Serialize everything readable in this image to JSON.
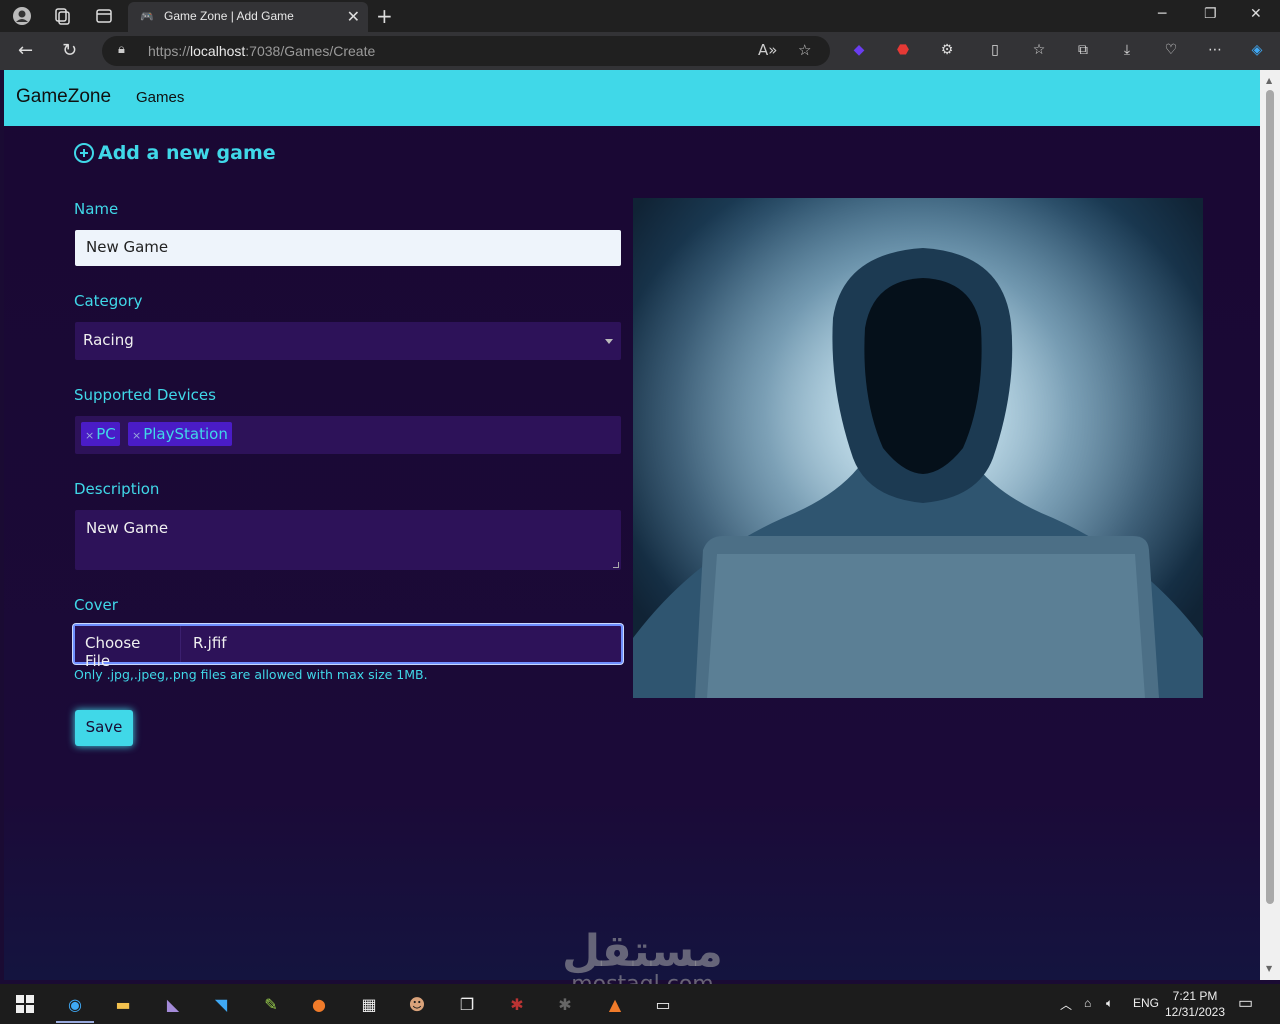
{
  "browser": {
    "tab_title": "Game Zone | Add Game",
    "url_prefix": "https://",
    "url_host": "localhost",
    "url_rest": ":7038/Games/Create"
  },
  "navbar": {
    "brand": "GameZone",
    "links": [
      "Games"
    ]
  },
  "form": {
    "title": "Add a new game",
    "name_label": "Name",
    "name_value": "New Game",
    "category_label": "Category",
    "category_value": "Racing",
    "devices_label": "Supported Devices",
    "devices": [
      "PC",
      "PlayStation"
    ],
    "chip_remove": "×",
    "description_label": "Description",
    "description_value": "New Game",
    "cover_label": "Cover",
    "file_button": "Choose File",
    "file_name": "R.jfif",
    "hint": "Only .jpg,.jpeg,.png files are allowed with max size 1MB.",
    "save_label": "Save"
  },
  "watermark": {
    "arabic": "مستقل",
    "latin": "mostaql.com"
  },
  "taskbar": {
    "lang": "ENG",
    "time": "7:21 PM",
    "date": "12/31/2023"
  },
  "colors": {
    "accent": "#40d8e8",
    "page_bg": "#1a0b33",
    "field_bg": "#2d1259",
    "chip_bg": "#4a1cc7"
  }
}
